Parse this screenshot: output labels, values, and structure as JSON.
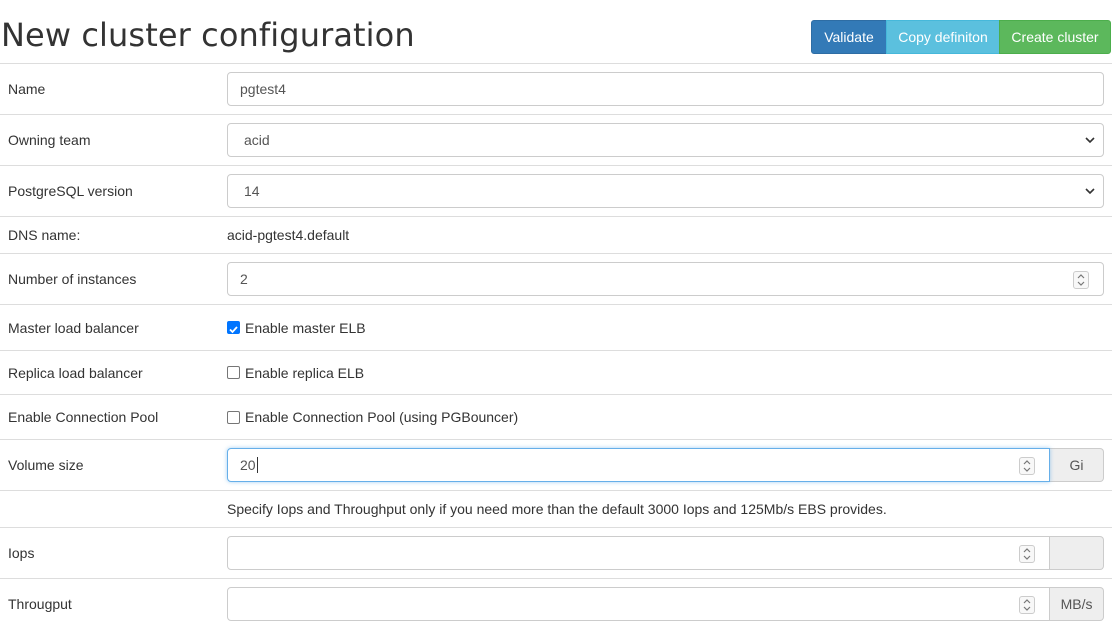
{
  "title": "New cluster configuration",
  "toolbar": {
    "validate_label": "Validate",
    "copy_label": "Copy definiton",
    "create_label": "Create cluster"
  },
  "form": {
    "name": {
      "label": "Name",
      "value": "pgtest4"
    },
    "team": {
      "label": "Owning team",
      "value": "acid"
    },
    "version": {
      "label": "PostgreSQL version",
      "value": "14"
    },
    "dns": {
      "label": "DNS name:",
      "value": "acid-pgtest4.default"
    },
    "instances": {
      "label": "Number of instances",
      "value": "2"
    },
    "master_lb": {
      "label": "Master load balancer",
      "option": "Enable master ELB",
      "checked": true
    },
    "replica_lb": {
      "label": "Replica load balancer",
      "option": "Enable replica ELB",
      "checked": false
    },
    "pool": {
      "label": "Enable Connection Pool",
      "option": "Enable Connection Pool (using PGBouncer)",
      "checked": false
    },
    "volume": {
      "label": "Volume size",
      "value": "20",
      "unit": "Gi"
    },
    "hint": "Specify Iops and Throughput only if you need more than the default 3000 Iops and 125Mb/s EBS provides.",
    "iops": {
      "label": "Iops",
      "value": "",
      "unit": ""
    },
    "throughput": {
      "label": "Througput",
      "value": "",
      "unit": "MB/s"
    }
  },
  "colors": {
    "primary": "#337ab7",
    "info": "#5bc0de",
    "success": "#5cb85c",
    "checkbox": "#0075ff"
  }
}
